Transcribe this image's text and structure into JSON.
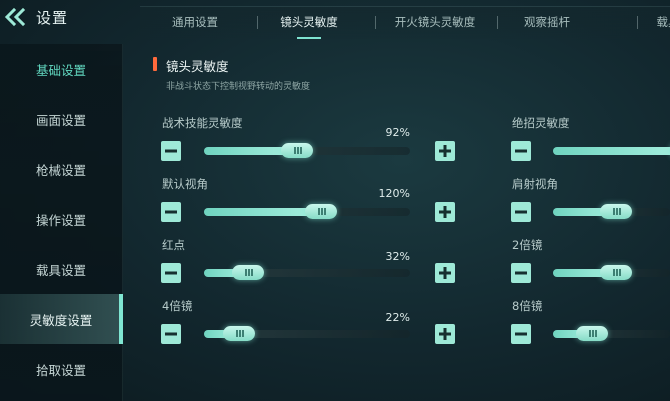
{
  "header": {
    "title": "设置",
    "back_icon": "double-chevron-left-icon"
  },
  "sidebar": {
    "items": [
      {
        "label": "基础设置",
        "state": "highlighted"
      },
      {
        "label": "画面设置",
        "state": "normal"
      },
      {
        "label": "枪械设置",
        "state": "normal"
      },
      {
        "label": "操作设置",
        "state": "normal"
      },
      {
        "label": "载具设置",
        "state": "normal"
      },
      {
        "label": "灵敏度设置",
        "state": "selected"
      },
      {
        "label": "拾取设置",
        "state": "normal"
      }
    ]
  },
  "tabs": [
    {
      "label": "通用设置",
      "active": false
    },
    {
      "label": "镜头灵敏度",
      "active": true
    },
    {
      "label": "开火镜头灵敏度",
      "active": false
    },
    {
      "label": "观察摇杆",
      "active": false
    },
    {
      "label": "载具",
      "active": false
    }
  ],
  "section": {
    "title": "镜头灵敏度",
    "subtitle": "非战斗状态下控制视野转动的灵敏度"
  },
  "sliders_left": [
    {
      "label": "战术技能灵敏度",
      "value_text": "92%",
      "fraction": 0.44
    },
    {
      "label": "默认视角",
      "value_text": "120%",
      "fraction": 0.58
    },
    {
      "label": "红点",
      "value_text": "32%",
      "fraction": 0.16
    },
    {
      "label": "4倍镜",
      "value_text": "22%",
      "fraction": 0.11
    }
  ],
  "sliders_right": [
    {
      "label": "绝招灵敏度",
      "fraction": 0.67
    },
    {
      "label": "肩射视角",
      "fraction": 0.27
    },
    {
      "label": "2倍镜",
      "fraction": 0.27
    },
    {
      "label": "8倍镜",
      "fraction": 0.13
    }
  ],
  "colors": {
    "accent": "#7ee3d0",
    "section_marker": "#ff6a3c",
    "sidebar_highlight": "#62d9c1"
  }
}
